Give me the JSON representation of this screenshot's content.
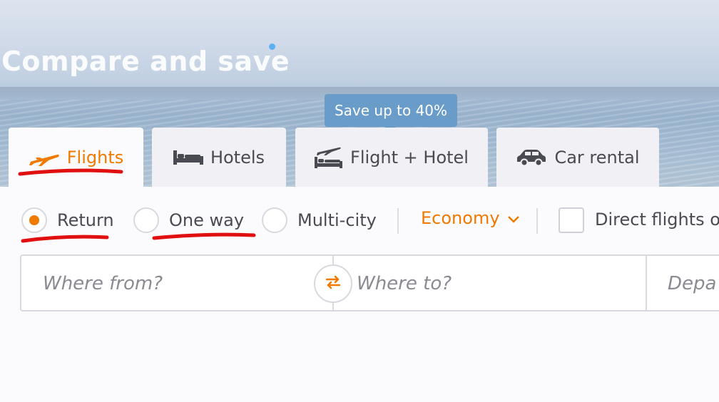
{
  "hero": {
    "title": "Compare and save"
  },
  "promo": {
    "label": "Save up to 40%"
  },
  "tabs": [
    {
      "label": "Flights",
      "icon": "plane-icon",
      "active": true
    },
    {
      "label": "Hotels",
      "icon": "bed-icon",
      "active": false
    },
    {
      "label": "Flight + Hotel",
      "icon": "plane-bed-icon",
      "active": false
    },
    {
      "label": "Car rental",
      "icon": "car-icon",
      "active": false
    }
  ],
  "trip_type": {
    "options": [
      {
        "label": "Return",
        "selected": true
      },
      {
        "label": "One way",
        "selected": false
      },
      {
        "label": "Multi-city",
        "selected": false
      }
    ]
  },
  "cabin_class": {
    "value": "Economy"
  },
  "direct_flights": {
    "label": "Direct flights o",
    "checked": false
  },
  "search": {
    "from_placeholder": "Where from?",
    "to_placeholder": "Where to?",
    "depart_placeholder": "Depa"
  },
  "colors": {
    "accent": "#f07a00",
    "promo": "#6a9cc9",
    "annotation": "#e01010"
  }
}
